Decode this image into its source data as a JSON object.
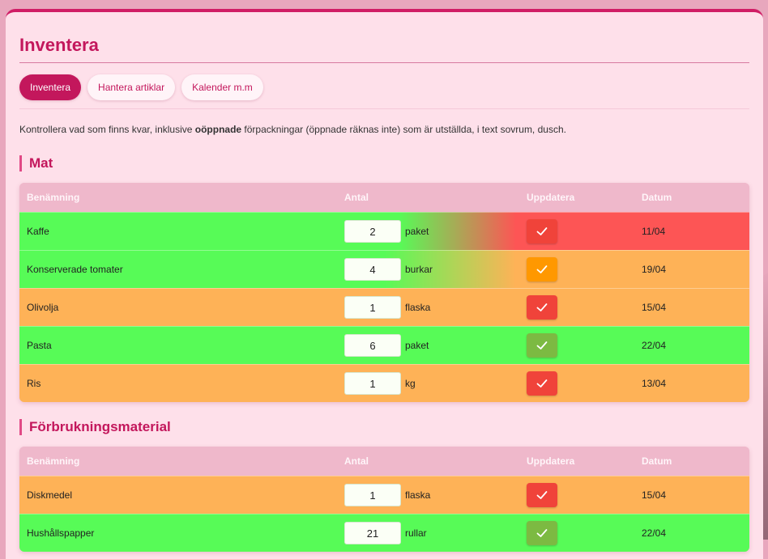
{
  "page": {
    "title": "Inventera",
    "intro_before": "Kontrollera vad som finns kvar, inklusive ",
    "intro_bold": "oöppnade",
    "intro_after": " förpackningar (öppnade räknas inte) som är utställda, i text sovrum, dusch."
  },
  "tabs": [
    {
      "label": "Inventera"
    },
    {
      "label": "Hantera artiklar"
    },
    {
      "label": "Kalender m.m"
    }
  ],
  "columns": {
    "name": "Benämning",
    "qty": "Antal",
    "update": "Uppdatera",
    "date": "Datum"
  },
  "colors": {
    "green": "#57fb57",
    "orange": "#feb257",
    "red": "#fd5555",
    "accent": "#c3175c"
  },
  "sections": [
    {
      "title": "Mat",
      "rows": [
        {
          "name": "Kaffe",
          "qty": "2",
          "unit": "paket",
          "date": "11/04",
          "status": "green-to-red",
          "button": "red"
        },
        {
          "name": "Konserverade tomater",
          "qty": "4",
          "unit": "burkar",
          "date": "19/04",
          "status": "green-to-orange",
          "button": "orange"
        },
        {
          "name": "Olivolja",
          "qty": "1",
          "unit": "flaska",
          "date": "15/04",
          "status": "orange",
          "button": "red"
        },
        {
          "name": "Pasta",
          "qty": "6",
          "unit": "paket",
          "date": "22/04",
          "status": "green",
          "button": "green"
        },
        {
          "name": "Ris",
          "qty": "1",
          "unit": "kg",
          "date": "13/04",
          "status": "orange",
          "button": "red"
        }
      ]
    },
    {
      "title": "Förbrukningsmaterial",
      "rows": [
        {
          "name": "Diskmedel",
          "qty": "1",
          "unit": "flaska",
          "date": "15/04",
          "status": "orange",
          "button": "red"
        },
        {
          "name": "Hushållspapper",
          "qty": "21",
          "unit": "rullar",
          "date": "22/04",
          "status": "green",
          "button": "green"
        }
      ]
    }
  ]
}
